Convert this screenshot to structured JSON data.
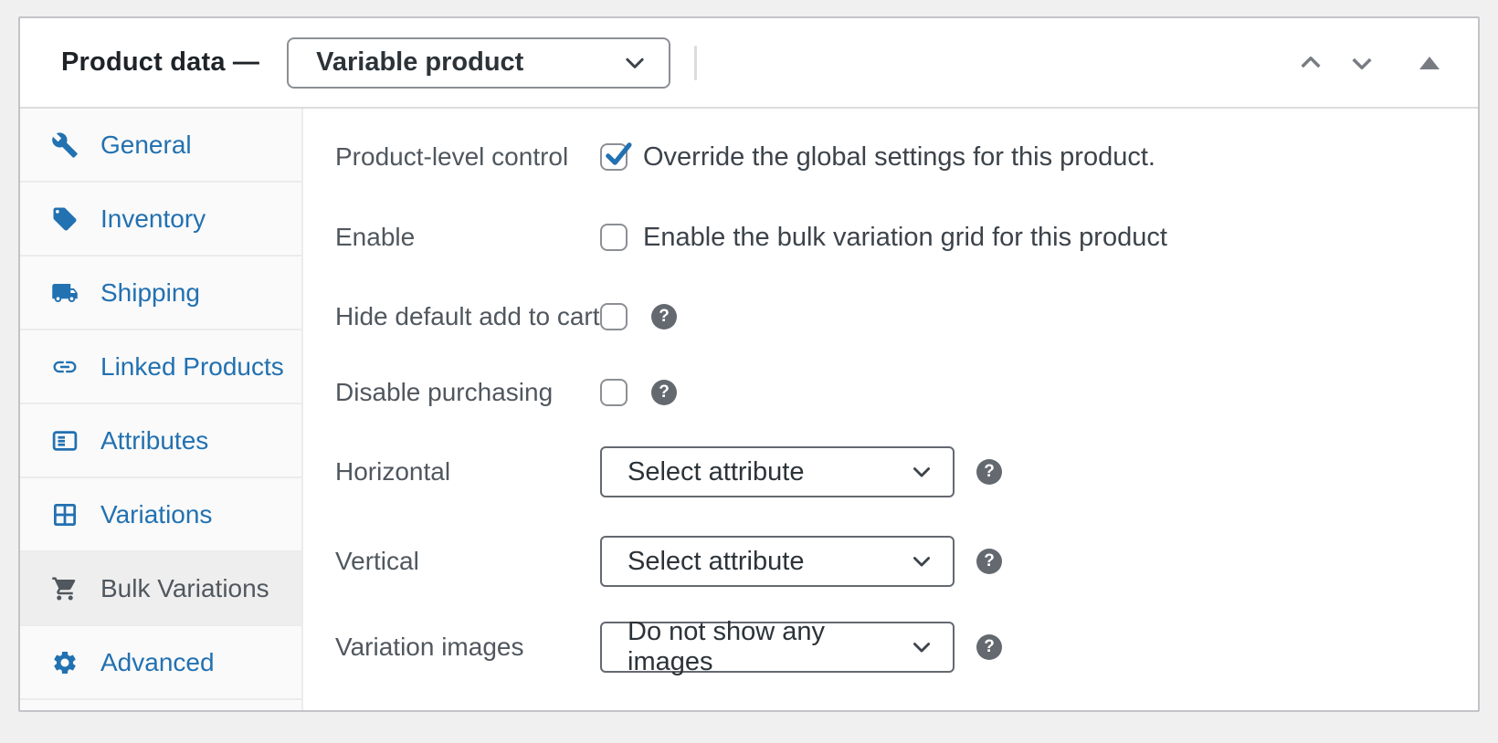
{
  "header": {
    "title": "Product data —",
    "product_type_select": {
      "value": "Variable product"
    }
  },
  "sidebar": {
    "items": [
      {
        "label": "General",
        "icon": "wrench-icon",
        "active": false
      },
      {
        "label": "Inventory",
        "icon": "tag-icon",
        "active": false
      },
      {
        "label": "Shipping",
        "icon": "truck-icon",
        "active": false
      },
      {
        "label": "Linked Products",
        "icon": "link-icon",
        "active": false
      },
      {
        "label": "Attributes",
        "icon": "attributes-card-icon",
        "active": false
      },
      {
        "label": "Variations",
        "icon": "grid-icon",
        "active": false
      },
      {
        "label": "Bulk Variations",
        "icon": "cart-icon",
        "active": true
      },
      {
        "label": "Advanced",
        "icon": "gear-icon",
        "active": false
      }
    ]
  },
  "panel": {
    "rows": [
      {
        "type": "checkbox",
        "label": "Product-level control",
        "checked": true,
        "text": "Override the global settings for this product.",
        "help": false
      },
      {
        "type": "checkbox",
        "label": "Enable",
        "checked": false,
        "text": "Enable the bulk variation grid for this product",
        "help": false
      },
      {
        "type": "checkbox",
        "label": "Hide default add to cart",
        "checked": false,
        "text": "",
        "help": true
      },
      {
        "type": "checkbox",
        "label": "Disable purchasing",
        "checked": false,
        "text": "",
        "help": true
      },
      {
        "type": "select",
        "label": "Horizontal",
        "value": "Select attribute",
        "help": true
      },
      {
        "type": "select",
        "label": "Vertical",
        "value": "Select attribute",
        "help": true
      },
      {
        "type": "select",
        "label": "Variation images",
        "value": "Do not show any images",
        "help": true
      }
    ],
    "help_icon_glyph": "?"
  },
  "colors": {
    "accent_blue": "#2271b1",
    "active_tab_text": "#50575e",
    "help_icon_bg": "#646970",
    "check_blue": "#2271b1"
  }
}
